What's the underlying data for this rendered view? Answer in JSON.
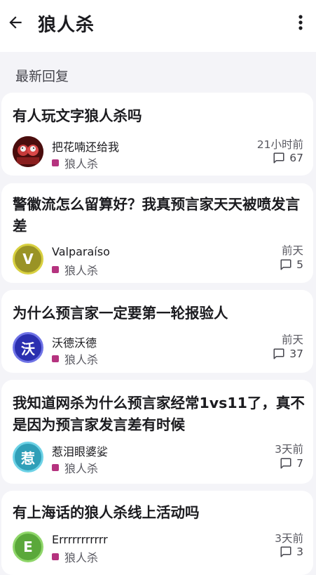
{
  "header": {
    "title": "狼人杀",
    "back_icon": "arrow-left-icon",
    "more_icon": "more-vert-icon"
  },
  "section": {
    "label": "最新回复"
  },
  "posts": [
    {
      "title": "有人玩文字狼人杀吗",
      "author": "把花喃还给我",
      "avatar_type": "photo",
      "avatar_letter": "",
      "avatar_color": "#7a1a1a",
      "tag": "狼人杀",
      "time": "21小时前",
      "replies": "67"
    },
    {
      "title": "警徽流怎么留算好？我真预言家天天被喷发言差",
      "author": "Valparaíso",
      "avatar_type": "letter",
      "avatar_letter": "V",
      "avatar_color": "#9a9325",
      "tag": "狼人杀",
      "time": "前天",
      "replies": "5"
    },
    {
      "title": "为什么预言家一定要第一轮报验人",
      "author": "沃德沃德",
      "avatar_type": "letter",
      "avatar_letter": "沃",
      "avatar_color": "#2b2fb0",
      "tag": "狼人杀",
      "time": "前天",
      "replies": "37"
    },
    {
      "title": "我知道网杀为什么预言家经常1vs11了，真不是因为预言家发言差有时候",
      "author": "惹泪眼婆娑",
      "avatar_type": "letter",
      "avatar_letter": "惹",
      "avatar_color": "#2f9fb8",
      "tag": "狼人杀",
      "time": "3天前",
      "replies": "7"
    },
    {
      "title": "有上海话的狼人杀线上活动吗",
      "author": "Errrrrrrrrrr",
      "avatar_type": "letter",
      "avatar_letter": "E",
      "avatar_color": "#5aa83a",
      "tag": "狼人杀",
      "time": "3天前",
      "replies": "3"
    }
  ],
  "colors": {
    "background": "#f4f4f8",
    "card": "#ffffff",
    "tag_dot": "#b5337f"
  }
}
